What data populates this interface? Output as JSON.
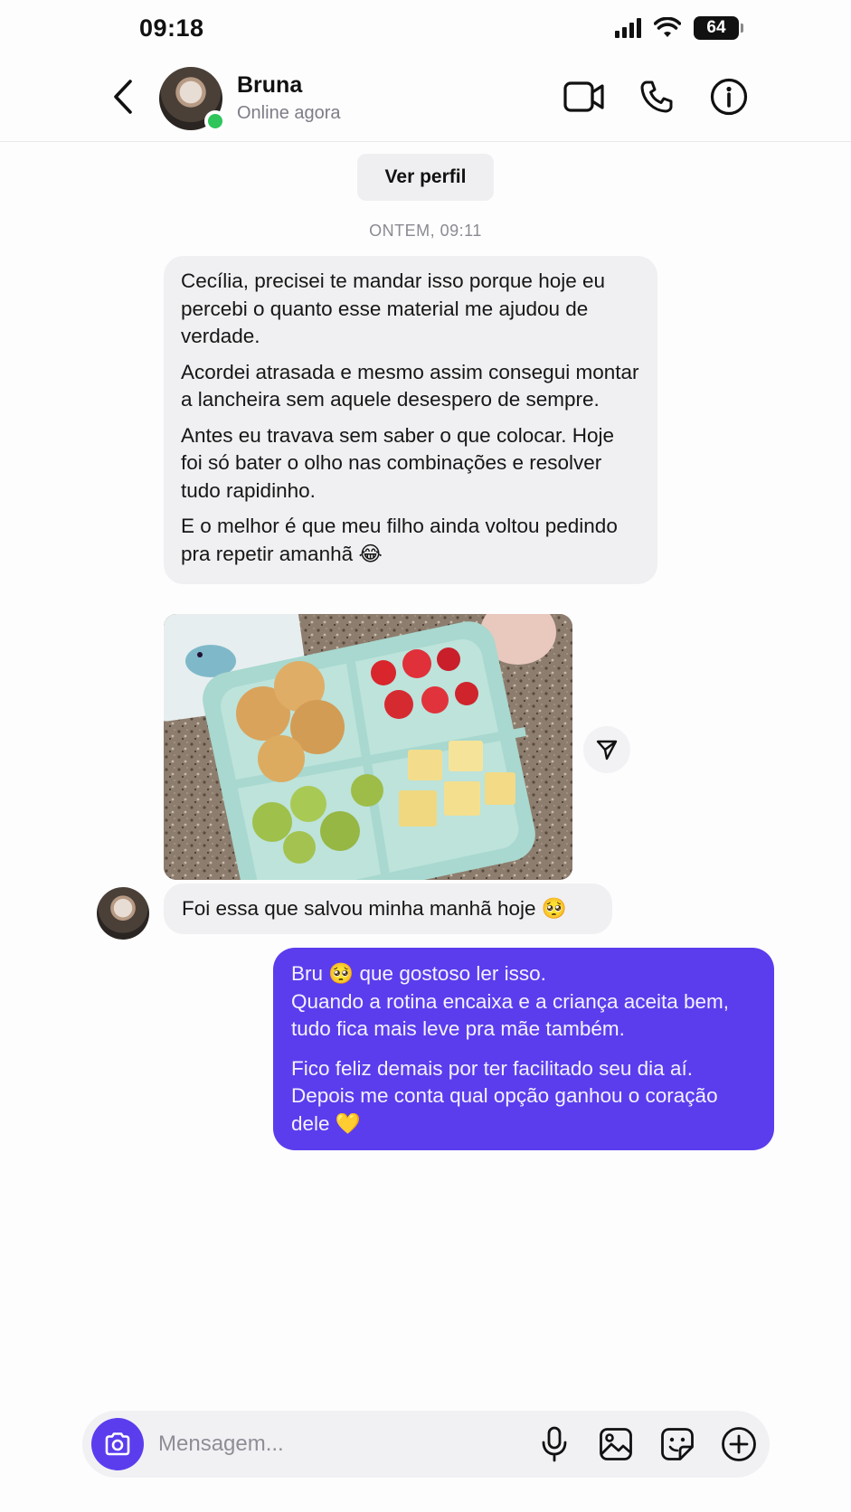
{
  "status_bar": {
    "time": "09:18",
    "battery": "64"
  },
  "header": {
    "contact_name": "Bruna",
    "contact_status": "Online agora",
    "icons": [
      "chevron-left-icon",
      "video-camera-icon",
      "phone-icon",
      "info-icon"
    ]
  },
  "chat": {
    "view_profile_label": "Ver perfil",
    "date_separator": "ONTEM, 09:11",
    "incoming_message": {
      "paragraphs": [
        "Cecília, precisei te mandar isso porque hoje eu percebi o quanto esse material me ajudou de verdade.",
        "Acordei atrasada e mesmo assim consegui montar a lancheira sem aquele desespero de sempre.",
        "Antes eu travava sem saber o que colocar. Hoje foi só bater o olho nas combinações e resolver tudo rapidinho.",
        "E o melhor é que meu filho ainda voltou pedindo pra repetir amanhã 😂"
      ]
    },
    "photo_caption": "Foi essa que salvou minha manhã hoje 🥺",
    "outgoing_message": {
      "paragraphs": [
        "Bru 🥺 que gostoso ler isso.\nQuando a rotina encaixa e a criança aceita bem, tudo fica mais leve pra mãe também.",
        "Fico feliz demais por ter facilitado seu dia aí. Depois me conta qual opção ganhou o coração dele 💛"
      ]
    }
  },
  "composer": {
    "placeholder": "Mensagem...",
    "value": "",
    "icons": [
      "camera-icon",
      "microphone-icon",
      "image-icon",
      "sticker-icon",
      "plus-circle-icon"
    ]
  },
  "colors": {
    "accent": "#5b3ded",
    "incoming_bubble": "#f0f0f2",
    "online": "#2fc55a"
  }
}
